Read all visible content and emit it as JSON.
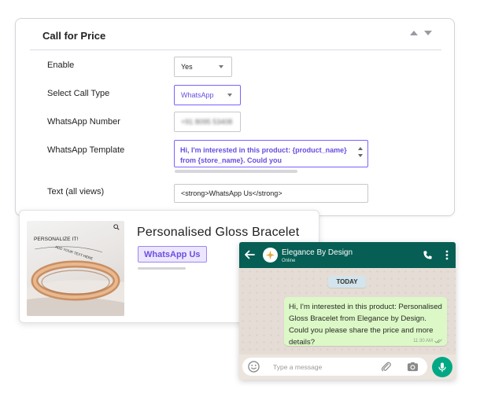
{
  "settings": {
    "title": "Call for Price",
    "rows": {
      "enable": {
        "label": "Enable",
        "value": "Yes"
      },
      "call_type": {
        "label": "Select Call Type",
        "value": "WhatsApp"
      },
      "whatsapp_number": {
        "label": "WhatsApp Number",
        "value": "+91 8095 53408"
      },
      "template": {
        "label": "WhatsApp Template",
        "value": "Hi, I'm interested in this product: {product_name} from {store_name}. Could you"
      },
      "text_all_views": {
        "label": "Text (all views)",
        "value": "<strong>WhatsApp Us</strong>"
      }
    }
  },
  "product": {
    "title": "Personalised Gloss Bracelet",
    "button_label": "WhatsApp Us",
    "image_caption": "PERSONALIZE IT!",
    "image_engraving": "ADD YOUR TEXT HERE"
  },
  "chat": {
    "contact_name": "Elegance By Design",
    "contact_status": "Online",
    "date_label": "TODAY",
    "message": "Hi, I'm interested in this product: Personalised Gloss Bracelet from Elegance by Design. Could you please share the price and more details?",
    "time": "11:30 AM",
    "input_placeholder": "Type a message"
  },
  "colors": {
    "accent_purple": "#7b61ff",
    "whatsapp_header": "#075e54",
    "whatsapp_green": "#00a884",
    "bubble": "#dcf8c6"
  },
  "icons": [
    "collapse-up-icon",
    "collapse-down-icon",
    "dropdown-caret-icon",
    "spinner-icon",
    "zoom-icon",
    "back-arrow-icon",
    "avatar-sparkle-icon",
    "phone-icon",
    "more-icon",
    "double-check-icon",
    "emoji-icon",
    "attach-icon",
    "camera-icon",
    "mic-icon"
  ]
}
